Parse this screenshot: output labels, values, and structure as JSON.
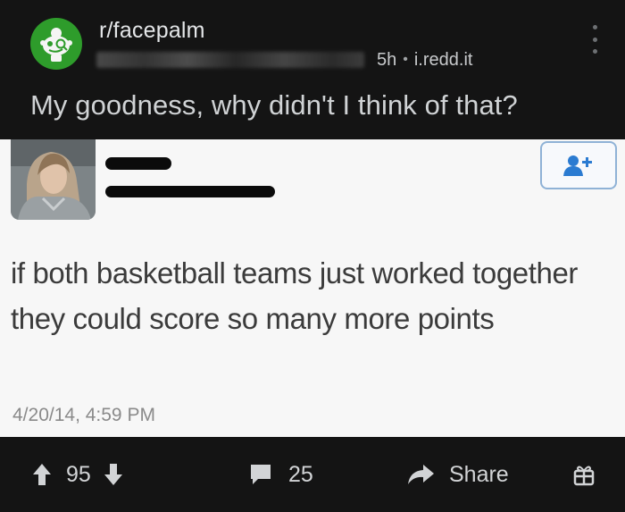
{
  "post": {
    "subreddit": "r/facepalm",
    "age": "5h",
    "domain": "i.redd.it",
    "title": "My goodness, why didn't I think of that?"
  },
  "tweet": {
    "text": "if both basketball teams just worked together they could score so many more points",
    "timestamp": "4/20/14, 4:59 PM"
  },
  "actions": {
    "score": "95",
    "comments": "25",
    "share_label": "Share"
  },
  "colors": {
    "background": "#141414",
    "subreddit_icon": "#2e9c2b",
    "tweet_background": "#f7f7f7",
    "follow_button": "#2b7bd1"
  },
  "icons": [
    "subreddit-snoo-icon",
    "more-options-icon",
    "follow-user-icon",
    "upvote-icon",
    "downvote-icon",
    "comment-icon",
    "share-icon",
    "award-icon"
  ]
}
